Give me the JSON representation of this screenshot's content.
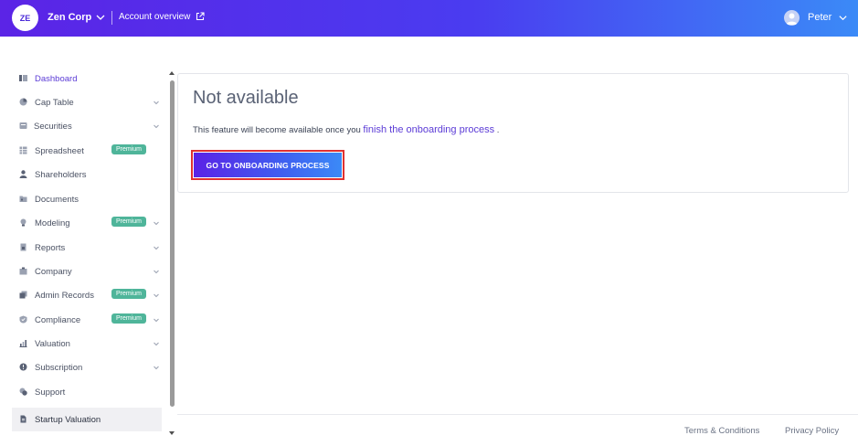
{
  "header": {
    "avatar_initials": "ZE",
    "company_name": "Zen Corp",
    "account_link": "Account overview",
    "user_name": "Peter"
  },
  "sidebar": {
    "items": [
      {
        "label": "Dashboard",
        "icon": "dashboard-icon",
        "active": true
      },
      {
        "label": "Cap Table",
        "icon": "pie-chart-icon",
        "chevron": true
      },
      {
        "label": "Securities",
        "icon": "securities-icon",
        "chevron": true
      },
      {
        "label": "Spreadsheet",
        "icon": "spreadsheet-icon",
        "badge": "Premium"
      },
      {
        "label": "Shareholders",
        "icon": "user-icon"
      },
      {
        "label": "Documents",
        "icon": "folder-icon"
      },
      {
        "label": "Modeling",
        "icon": "bulb-icon",
        "badge": "Premium",
        "chevron": true
      },
      {
        "label": "Reports",
        "icon": "report-icon",
        "chevron": true
      },
      {
        "label": "Company",
        "icon": "company-icon",
        "chevron": true
      },
      {
        "label": "Admin Records",
        "icon": "records-icon",
        "badge": "Premium",
        "chevron": true
      },
      {
        "label": "Compliance",
        "icon": "shield-icon",
        "badge": "Premium",
        "chevron": true
      },
      {
        "label": "Valuation",
        "icon": "valuation-icon",
        "chevron": true
      },
      {
        "label": "Subscription",
        "icon": "subscription-icon",
        "chevron": true
      },
      {
        "label": "Support",
        "icon": "support-icon"
      },
      {
        "label": "Startup Valuation",
        "icon": "document-icon",
        "selected": true
      }
    ]
  },
  "main": {
    "title": "Not available",
    "text_before": "This feature will become available once you ",
    "text_link": "finish the onboarding process",
    "text_after": " .",
    "cta_label": "GO TO ONBOARDING PROCESS"
  },
  "footer": {
    "terms": "Terms & Conditions",
    "privacy": "Privacy Policy"
  },
  "colors": {
    "accent": "#5b3bd6",
    "premium_badge": "#4fb59a",
    "highlight_outline": "#e03131"
  }
}
